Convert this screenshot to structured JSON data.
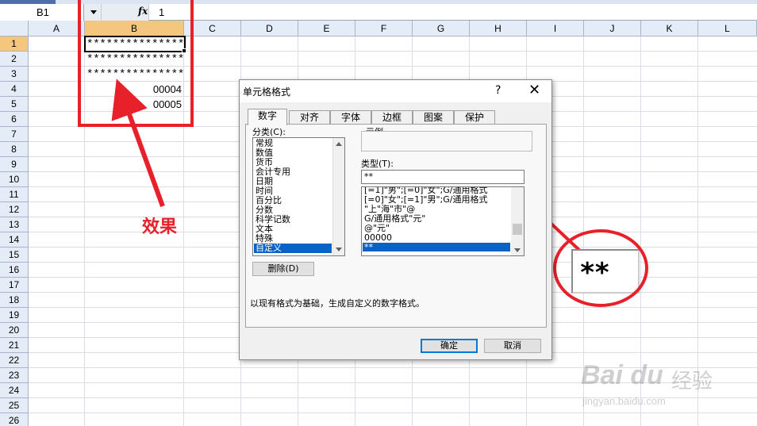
{
  "formula_bar": {
    "name_box": "B1",
    "fx_label": "fx",
    "formula_value": "1"
  },
  "sheet": {
    "columns": [
      "A",
      "B",
      "C",
      "D",
      "E",
      "F",
      "G",
      "H",
      "I",
      "J",
      "K",
      "L"
    ],
    "selected_column": "B",
    "rows": [
      "1",
      "2",
      "3",
      "4",
      "5",
      "6",
      "7",
      "8",
      "9",
      "10",
      "11",
      "12",
      "13",
      "14",
      "15",
      "16",
      "17",
      "18",
      "19",
      "20",
      "21",
      "22",
      "23",
      "24",
      "25",
      "26"
    ],
    "selected_row": "1",
    "cells_b": [
      "***************",
      "***************",
      "***************",
      "00004",
      "00005"
    ]
  },
  "annotation": {
    "effect_label": "效果",
    "zoom_value": "**",
    "color": "#e8202a"
  },
  "dialog": {
    "title": "单元格格式",
    "help": "?",
    "close": "✕",
    "tabs": [
      "数字",
      "对齐",
      "字体",
      "边框",
      "图案",
      "保护"
    ],
    "active_tab": "数字",
    "category_label": "分类(C):",
    "categories": [
      "常规",
      "数值",
      "货币",
      "会计专用",
      "日期",
      "时间",
      "百分比",
      "分数",
      "科学记数",
      "文本",
      "特殊",
      "自定义"
    ],
    "selected_category": "自定义",
    "sample_label": "示例",
    "type_label": "类型(T):",
    "type_value": "**",
    "type_list": [
      "[=1]\"男\";[=0]\"女\";G/通用格式",
      "[=0]\"女\";[=1]\"男\";G/通用格式",
      "\"上\"海\"市\"@",
      "G/通用格式\"元\"",
      "@\"元\"",
      "00000",
      "**"
    ],
    "selected_type": "**",
    "delete_button": "删除(D)",
    "description": "以现有格式为基础，生成自定义的数字格式。",
    "ok_button": "确定",
    "cancel_button": "取消"
  },
  "watermark": {
    "brand": "Bai du",
    "brand_cn": "经验",
    "url": "jingyan.baidu.com"
  }
}
